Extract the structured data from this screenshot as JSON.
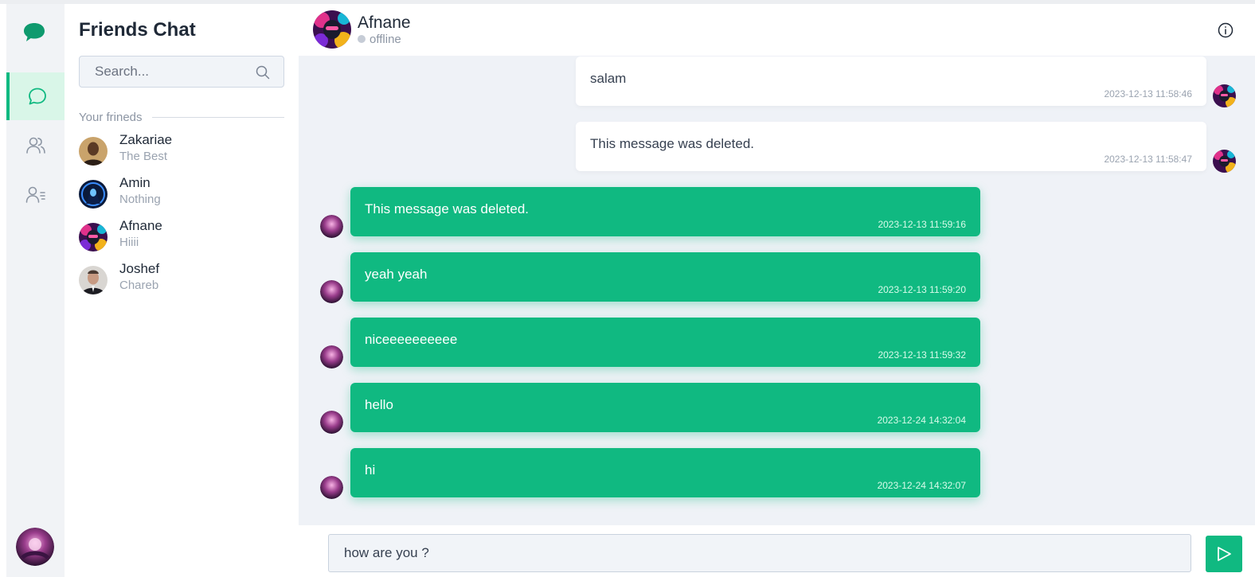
{
  "app": {
    "title": "Friends Chat"
  },
  "sidebar": {
    "nav": [
      {
        "icon": "chat-bubble-icon",
        "active": true
      },
      {
        "icon": "users-icon",
        "active": false
      },
      {
        "icon": "user-list-icon",
        "active": false
      }
    ]
  },
  "search": {
    "placeholder": "Search...",
    "value": ""
  },
  "friends": {
    "section_label": "Your frineds",
    "items": [
      {
        "name": "Zakariae",
        "status": "The Best"
      },
      {
        "name": "Amin",
        "status": "Nothing"
      },
      {
        "name": "Afnane",
        "status": "Hiiii"
      },
      {
        "name": "Joshef",
        "status": "Chareb"
      }
    ]
  },
  "chat": {
    "header": {
      "name": "Afnane",
      "status": "offline"
    },
    "messages": [
      {
        "direction": "sent",
        "text": "salam",
        "time": "2023-12-13 11:58:46"
      },
      {
        "direction": "sent",
        "text": "This message was deleted.",
        "time": "2023-12-13 11:58:47"
      },
      {
        "direction": "received",
        "text": "This message was deleted.",
        "time": "2023-12-13 11:59:16"
      },
      {
        "direction": "received",
        "text": "yeah yeah",
        "time": "2023-12-13 11:59:20"
      },
      {
        "direction": "received",
        "text": "niceeeeeeeeee",
        "time": "2023-12-13 11:59:32"
      },
      {
        "direction": "received",
        "text": "hello",
        "time": "2023-12-24 14:32:04"
      },
      {
        "direction": "received",
        "text": "hi",
        "time": "2023-12-24 14:32:07"
      }
    ],
    "composer": {
      "value": "how are you ?"
    }
  },
  "colors": {
    "accent": "#10b981",
    "rail_bg": "#f1f3f6",
    "messages_bg": "#eff2f7"
  }
}
